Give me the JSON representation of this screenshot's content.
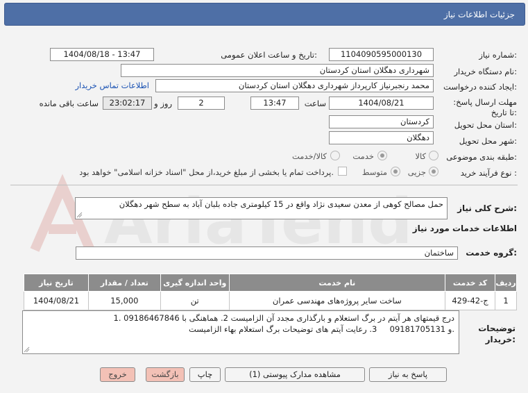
{
  "window": {
    "title": "جزئیات اطلاعات نیاز"
  },
  "form": {
    "need_number": {
      "label": "شماره نیاز:",
      "value": "1104090595000130"
    },
    "announce_datetime": {
      "label": "تاریخ و ساعت اعلان عمومی:",
      "value": "1404/08/18 - 13:47"
    },
    "buyer_org": {
      "label": "نام دستگاه خریدار:",
      "value": "شهرداری دهگلان استان کردستان"
    },
    "requester": {
      "label": "ایجاد کننده درخواست:",
      "value": "محمد رنجبرنیاز کارپرداز شهرداری دهگلان استان کردستان"
    },
    "buyer_contact_link": "اطلاعات تماس خریدار",
    "deadline": {
      "label": "مهلت ارسال پاسخ: تا تاریخ:",
      "date": "1404/08/21",
      "time_label": "ساعت",
      "time": "13:47",
      "days": "2",
      "days_label": "روز و",
      "remaining": "23:02:17",
      "remaining_label": "ساعت باقی مانده"
    },
    "province": {
      "label": "استان محل تحویل:",
      "value": "کردستان"
    },
    "city": {
      "label": "شهر محل تحویل:",
      "value": "دهگلان"
    },
    "category": {
      "label": "طبقه بندی موضوعی:",
      "options": [
        "کالا",
        "خدمت",
        "کالا/خدمت"
      ],
      "selected": "خدمت"
    },
    "process_type": {
      "label": "نوع فرآیند خرید :",
      "options": [
        "جزیی",
        "متوسط"
      ],
      "selected": "جزیی",
      "payment_note": "پرداخت تمام یا بخشی از مبلغ خرید،از محل \"اسناد خزانه اسلامی\" خواهد بود."
    }
  },
  "description": {
    "label": "شرح کلی نیاز:",
    "value": "حمل مصالح کوهی از معدن سعیدی نژاد واقع در 15 کیلومتری جاده بلبان آباد به سطح شهر دهگلان"
  },
  "services": {
    "section_title": "اطلاعات خدمات مورد نیاز",
    "group_label": "گروه خدمت:",
    "group_value": "ساختمان",
    "table": {
      "headers": [
        "ردیف",
        "کد خدمت",
        "نام خدمت",
        "واحد اندازه گیری",
        "تعداد / مقدار",
        "تاریخ نیاز"
      ],
      "rows": [
        [
          "1",
          "ج-42-429",
          "ساخت سایر پروژه‌های مهندسی عمران",
          "تن",
          "15,000",
          "1404/08/21"
        ]
      ]
    }
  },
  "buyer_notes": {
    "label": "توضیحات خریدار:",
    "line1": "1. درج قیمتهای هر آیتم در برگ استعلام و بارگذاری مجدد آن الزامیست 2. هماهنگی با 09186467846",
    "line2": "و 09181705131     3. رعایت آیتم های توضیحات برگ استعلام بهاء الزامیست."
  },
  "buttons": {
    "reply": "پاسخ به نیاز",
    "attachments": "مشاهده مدارک پیوستی (1)",
    "print": "چاپ",
    "back": "بازگشت",
    "exit": "خروج"
  },
  "watermark": "AriaTender.net"
}
